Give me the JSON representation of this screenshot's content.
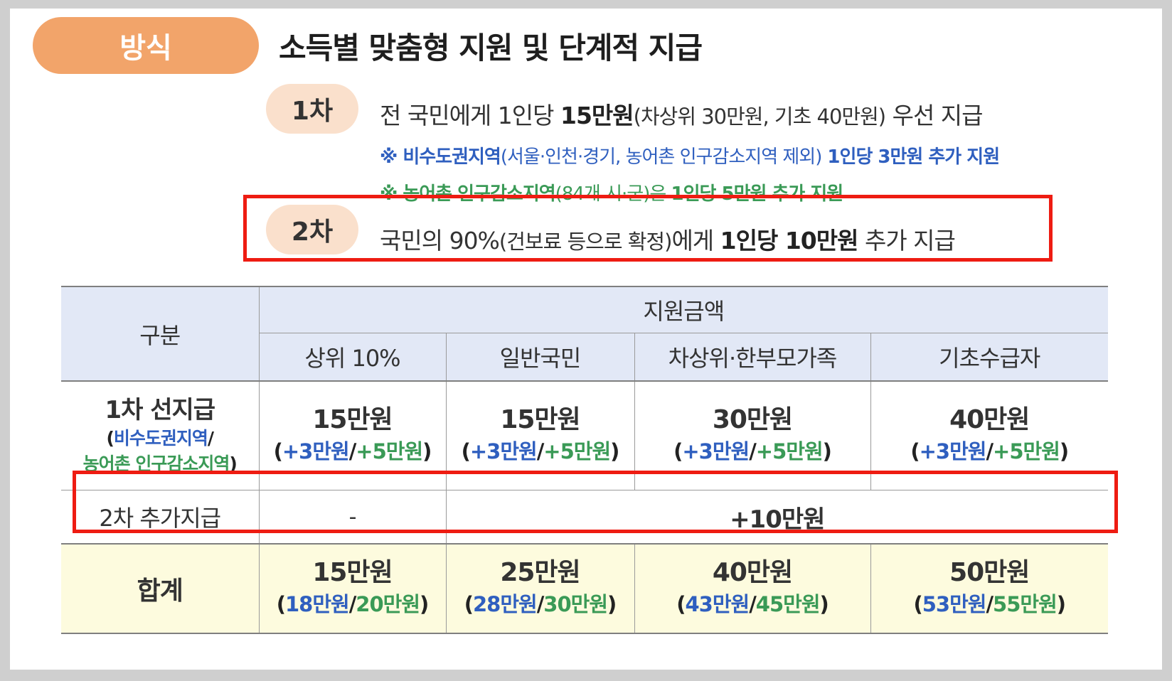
{
  "method_label": "방식",
  "main_title": "소득별 맞춤형 지원 및 단계적 지급",
  "stage1": {
    "label": "1차",
    "line_a": "전 국민에게 1인당 ",
    "line_b": "15만원",
    "line_c": "(차상위 30만원, 기초 40만원)",
    "line_d": " 우선 지급",
    "note_blue_a": "※ 비수도권지역",
    "note_blue_b": "(서울·인천·경기, 농어촌 인구감소지역 제외)",
    "note_blue_c": " 1인당 3만원 추가 지원",
    "note_green_a": "※ 농어촌 인구감소지역",
    "note_green_b": "(84개 시·군)",
    "note_green_c": "은 ",
    "note_green_d": "1인당 5만원 추가 지원"
  },
  "stage2": {
    "label": "2차",
    "line_a": "국민의 90%",
    "line_b": "(건보료 등으로 확정)",
    "line_c": "에게 ",
    "line_d": "1인당 10만원",
    "line_e": " 추가 지급"
  },
  "table": {
    "col_category": "구분",
    "col_group": "지원금액",
    "columns": [
      "상위 10%",
      "일반국민",
      "차상위·한부모가족",
      "기초수급자"
    ],
    "row1": {
      "label": "1차 선지급",
      "label_paren_open": "(",
      "label_blue": "비수도권지역",
      "label_slash": "/",
      "label_green": "농어촌 인구감소지역",
      "label_paren_close": ")",
      "amounts": [
        "15만원",
        "15만원",
        "30만원",
        "40만원"
      ],
      "extra_open": "(",
      "extra_blue": "+3만원",
      "extra_slash": "/",
      "extra_green": "+5만원",
      "extra_close": ")"
    },
    "row2": {
      "label": "2차 추가지급",
      "first": "-",
      "rest": "+10만원"
    },
    "row3": {
      "label": "합계",
      "amounts": [
        "15만원",
        "25만원",
        "40만원",
        "50만원"
      ],
      "blue": [
        "18만원",
        "28만원",
        "43만원",
        "53만원"
      ],
      "green": [
        "20만원",
        "30만원",
        "45만원",
        "55만원"
      ],
      "open": "(",
      "slash": "/",
      "close": ")"
    }
  },
  "colors": {
    "method_pill": "#f2a46a",
    "stage_pill": "#fae0cc",
    "highlight_box": "#ee1c12",
    "blue_text": "#2f5fbf",
    "green_text": "#3a9a56",
    "header_bg": "#e2e8f6",
    "total_bg": "#fdfbde"
  }
}
